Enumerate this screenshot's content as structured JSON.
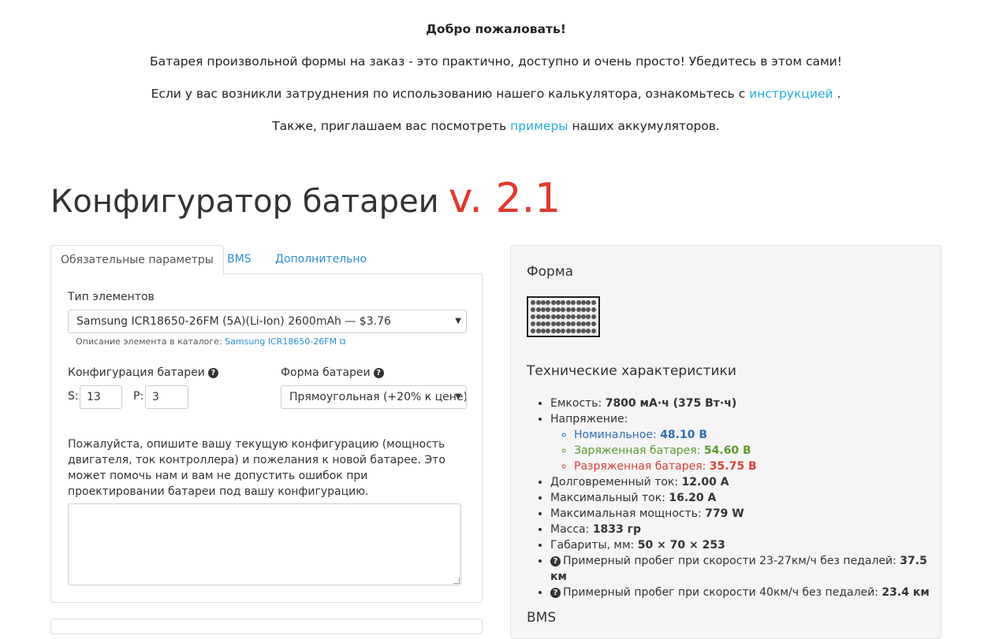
{
  "intro": {
    "welcome": "Добро пожаловать!",
    "line1": "Батарея произвольной формы на заказ - это практично, доступно и очень просто! Убедитесь в этом сами!",
    "line2_prefix": "Если у вас возникли затруднения по использованию нашего калькулятора, ознакомьтесь с ",
    "line2_link": "инструкцией",
    "line2_suffix": " .",
    "line3_prefix": "Также, приглашаем вас посмотреть ",
    "line3_link": "примеры",
    "line3_suffix": " наших аккумуляторов."
  },
  "header": {
    "title": "Конфигуратор батареи",
    "version": "v. 2.1"
  },
  "tabs": [
    {
      "label": "Обязательные параметры",
      "active": true
    },
    {
      "label": "BMS",
      "active": false
    },
    {
      "label": "Дополнительно",
      "active": false
    }
  ],
  "form": {
    "cell_type_label": "Тип элементов",
    "cell_type_value": "Samsung ICR18650-26FM (5A)(Li-Ion) 2600mAh — $3.76",
    "catalog_prefix": "Описание элемента в каталоге: ",
    "catalog_link": "Samsung ICR18650-26FM",
    "config_label": "Конфигурация батареи",
    "s_label": "S:",
    "s_value": "13",
    "p_label": "P:",
    "p_value": "3",
    "shape_label": "Форма батареи",
    "shape_value": "Прямоугольная (+20% к цене)",
    "help_text": "Пожалуйста, опишите вашу текущую конфигурацию (мощность двигателя, ток контроллера) и пожелания к новой батарее. Это может помочь нам и вам не допустить ошибок при проектировании батареи под вашу конфигурацию.",
    "comment_value": ""
  },
  "right": {
    "shape_heading": "Форма",
    "shape_grid": {
      "columns": 13,
      "rows": 5
    },
    "specs_heading": "Технические характеристики",
    "capacity_label": "Емкость: ",
    "capacity_value": "7800 мА·ч (375 Вт·ч)",
    "voltage_label": "Напряжение:",
    "nominal_label": "Номинальное: ",
    "nominal_value": "48.10 В",
    "charged_label": "Заряженная батарея: ",
    "charged_value": "54.60 В",
    "discharged_label": "Разряженная батарея: ",
    "discharged_value": "35.75 В",
    "cont_current_label": "Долговременный ток: ",
    "cont_current_value": "12.00 А",
    "max_current_label": "Максимальный ток: ",
    "max_current_value": "16.20 А",
    "max_power_label": "Максимальная мощность: ",
    "max_power_value": "779 W",
    "mass_label": "Масса: ",
    "mass_value": "1833 гр",
    "dims_label": "Габариты, мм: ",
    "dims_value": "50 × 70 × 253",
    "range1_label": "Примерный пробег при скорости 23-27км/ч без педалей: ",
    "range1_value": "37.5 км",
    "range2_label": "Примерный пробег при скорости 40км/ч без педалей: ",
    "range2_value": "23.4 км",
    "bms_heading": "BMS"
  },
  "colors": {
    "link": "#23aee0",
    "version": "#e0392d",
    "nominal": "#2f6eb5",
    "charged": "#5a9c2e",
    "discharged": "#d9413b"
  }
}
